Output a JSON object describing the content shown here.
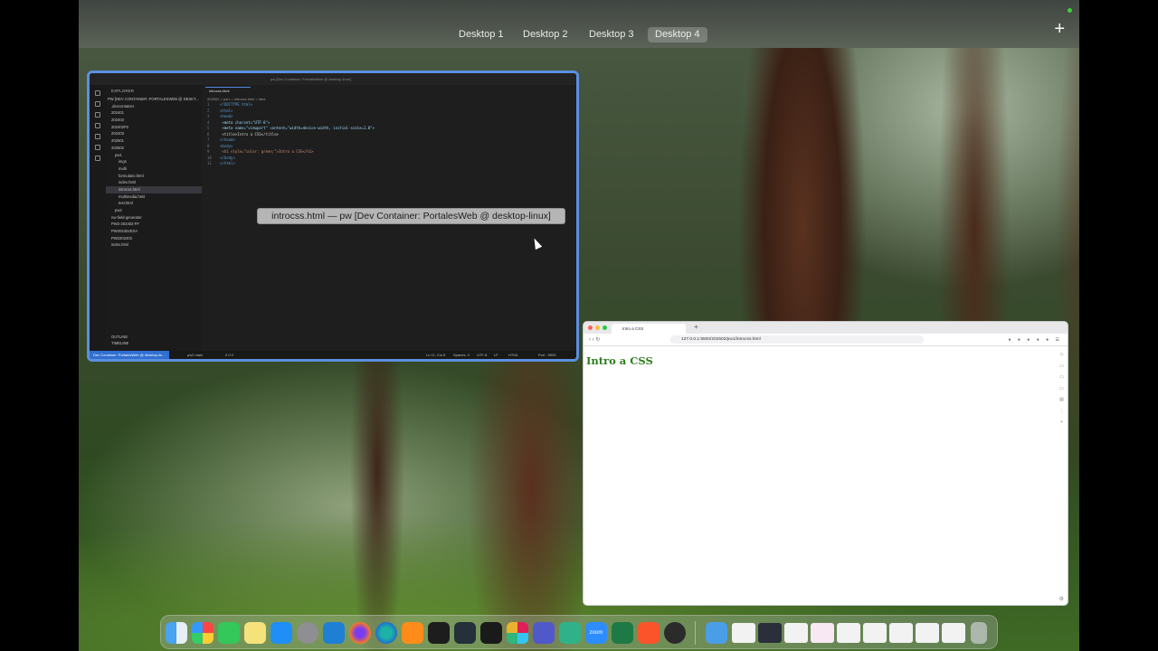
{
  "desktops": [
    "Desktop 1",
    "Desktop 2",
    "Desktop 3",
    "Desktop 4"
  ],
  "active_desktop": "Desktop 4",
  "add_desktop_label": "+",
  "vscode": {
    "window_title": "pw [Dev Container: PortalesWeb @ desktop-linux]",
    "tooltip": "introcss.html — pw [Dev Container: PortalesWeb @ desktop-linux]",
    "explorer_header": "EXPLORER",
    "workspace": "PW [DEV CONTAINER: PORTALESWEB @ DESKT...",
    "tree": [
      ".devcontainer",
      "202401",
      "202402",
      "202402P2",
      "202403",
      "202501",
      "202502",
      "pw1",
      "imgs",
      "multi",
      "formulario.html",
      "index.html",
      "introcss.html",
      "multimedia.html",
      "test.html",
      "pw2",
      "nw-field-generator",
      "PW2-202402-FF",
      "PW202402EXA",
      "PW2202402",
      "index.html"
    ],
    "outline": "OUTLINE",
    "timeline": "TIMELINE",
    "tab": "introcss.html",
    "breadcrumb": "202502 > pw1 > introcss.html > html",
    "code_lines": [
      "<!DOCTYPE html>",
      "<html>",
      "<head>",
      "  <meta charset=\"UTF-8\">",
      "  <meta name=\"viewport\" content=\"width=device-width, initial-scale=1.0\">",
      "  <title>Intro a CSS</title>",
      "</head>",
      "<body>",
      "  <h1 style=\"color: green;\">Intro a CSS</h1>",
      "</body>",
      "</html>"
    ],
    "status_remote": "Dev Container: PortalesWeb @ desktop-lin...",
    "status_branch": "pw2  main",
    "status_problems": "0  0  0",
    "status_position": "Ln 11, Col 8",
    "status_spaces": "Spaces: 4",
    "status_encoding": "UTF-8",
    "status_eol": "LF",
    "status_lang": "HTML",
    "status_port": "Port : 5500"
  },
  "browser": {
    "tab_title": "Intro a CSS",
    "new_tab": "+",
    "url": "127.0.0.1:5500/202502/pw1/introcss.html",
    "heading": "Intro a CSS",
    "heading_color": "#2e7d1f"
  },
  "dock_apps": [
    "finder-icon",
    "launchpad-icon",
    "facetime-icon",
    "notes-icon",
    "app-store-icon",
    "system-settings-icon",
    "vscode-icon",
    "firefox-icon",
    "edge-icon",
    "books-icon",
    "terminal-icon",
    "affinity-icon",
    "activity-monitor-icon",
    "slack-icon",
    "teams-icon",
    "copilot-icon",
    "zoom-icon",
    "excel-icon",
    "brave-icon",
    "clock-icon"
  ],
  "zoom_label": "zoom"
}
